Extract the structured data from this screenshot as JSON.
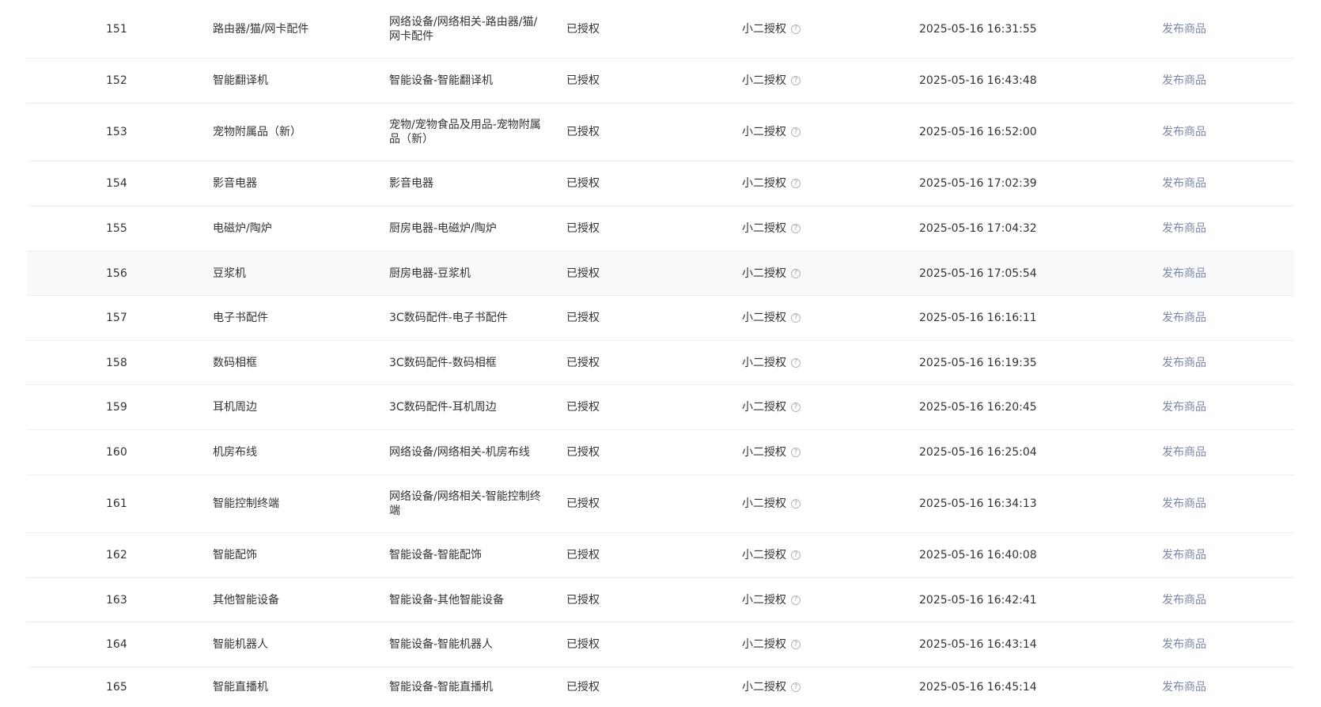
{
  "table": {
    "rows": [
      {
        "id": "151",
        "name": "路由器/猫/网卡配件",
        "path": "网络设备/网络相关-路由器/猫/网卡配件",
        "status": "已授权",
        "auth": "小二授权",
        "time": "2025-05-16 16:31:55",
        "action": "发布商品"
      },
      {
        "id": "152",
        "name": "智能翻译机",
        "path": "智能设备-智能翻译机",
        "status": "已授权",
        "auth": "小二授权",
        "time": "2025-05-16 16:43:48",
        "action": "发布商品"
      },
      {
        "id": "153",
        "name": "宠物附属品（新）",
        "path": "宠物/宠物食品及用品-宠物附属品（新）",
        "status": "已授权",
        "auth": "小二授权",
        "time": "2025-05-16 16:52:00",
        "action": "发布商品"
      },
      {
        "id": "154",
        "name": "影音电器",
        "path": "影音电器",
        "status": "已授权",
        "auth": "小二授权",
        "time": "2025-05-16 17:02:39",
        "action": "发布商品"
      },
      {
        "id": "155",
        "name": "电磁炉/陶炉",
        "path": "厨房电器-电磁炉/陶炉",
        "status": "已授权",
        "auth": "小二授权",
        "time": "2025-05-16 17:04:32",
        "action": "发布商品"
      },
      {
        "id": "156",
        "name": "豆浆机",
        "path": "厨房电器-豆浆机",
        "status": "已授权",
        "auth": "小二授权",
        "time": "2025-05-16 17:05:54",
        "action": "发布商品"
      },
      {
        "id": "157",
        "name": "电子书配件",
        "path": "3C数码配件-电子书配件",
        "status": "已授权",
        "auth": "小二授权",
        "time": "2025-05-16 16:16:11",
        "action": "发布商品"
      },
      {
        "id": "158",
        "name": "数码相框",
        "path": "3C数码配件-数码相框",
        "status": "已授权",
        "auth": "小二授权",
        "time": "2025-05-16 16:19:35",
        "action": "发布商品"
      },
      {
        "id": "159",
        "name": "耳机周边",
        "path": "3C数码配件-耳机周边",
        "status": "已授权",
        "auth": "小二授权",
        "time": "2025-05-16 16:20:45",
        "action": "发布商品"
      },
      {
        "id": "160",
        "name": "机房布线",
        "path": "网络设备/网络相关-机房布线",
        "status": "已授权",
        "auth": "小二授权",
        "time": "2025-05-16 16:25:04",
        "action": "发布商品"
      },
      {
        "id": "161",
        "name": "智能控制终端",
        "path": "网络设备/网络相关-智能控制终端",
        "status": "已授权",
        "auth": "小二授权",
        "time": "2025-05-16 16:34:13",
        "action": "发布商品"
      },
      {
        "id": "162",
        "name": "智能配饰",
        "path": "智能设备-智能配饰",
        "status": "已授权",
        "auth": "小二授权",
        "time": "2025-05-16 16:40:08",
        "action": "发布商品"
      },
      {
        "id": "163",
        "name": "其他智能设备",
        "path": "智能设备-其他智能设备",
        "status": "已授权",
        "auth": "小二授权",
        "time": "2025-05-16 16:42:41",
        "action": "发布商品"
      },
      {
        "id": "164",
        "name": "智能机器人",
        "path": "智能设备-智能机器人",
        "status": "已授权",
        "auth": "小二授权",
        "time": "2025-05-16 16:43:14",
        "action": "发布商品"
      },
      {
        "id": "165",
        "name": "智能直播机",
        "path": "智能设备-智能直播机",
        "status": "已授权",
        "auth": "小二授权",
        "time": "2025-05-16 16:45:14",
        "action": "发布商品"
      }
    ],
    "help_icon": "question-circle-icon",
    "link_color": "#7a88a8"
  }
}
